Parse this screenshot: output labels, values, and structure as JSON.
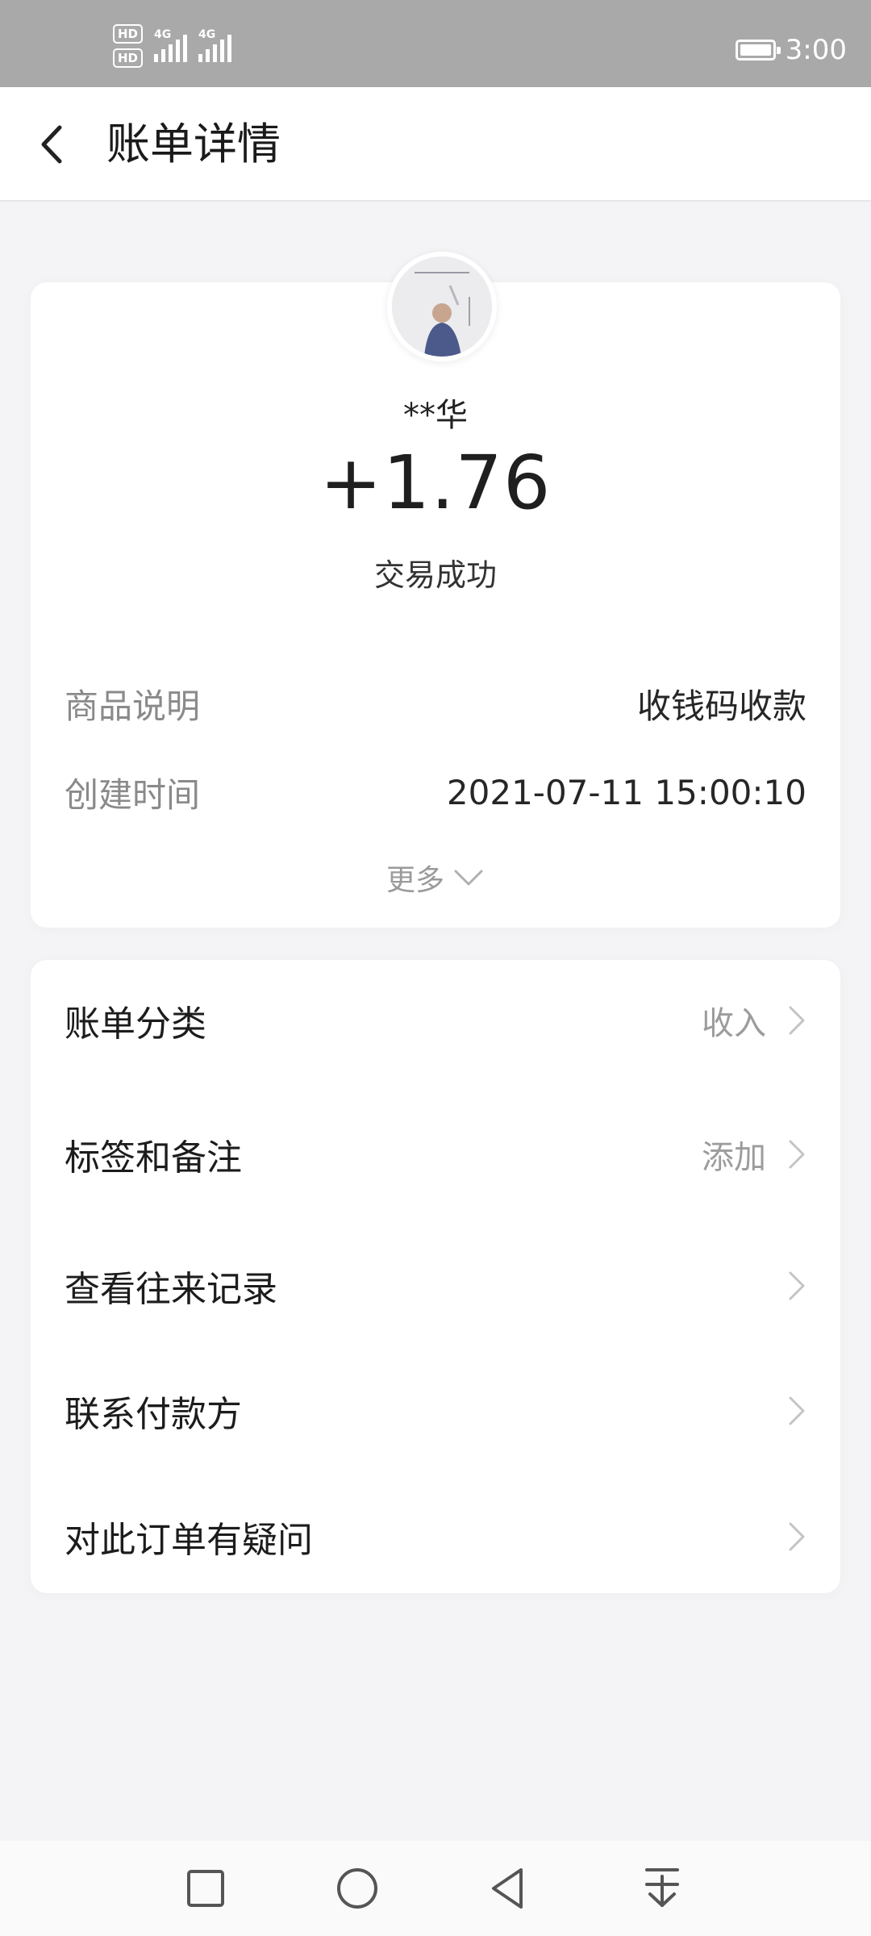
{
  "status_bar": {
    "sim1_tag": "HD",
    "sim2_tag": "HD",
    "sim1_gen": "4G",
    "sim2_gen": "4G",
    "time": "3:00"
  },
  "header": {
    "title": "账单详情"
  },
  "summary": {
    "counterparty": "**华",
    "amount": "+1.76",
    "status": "交易成功",
    "details": [
      {
        "label": "商品说明",
        "value": "收钱码收款"
      },
      {
        "label": "创建时间",
        "value": "2021-07-11 15:00:10"
      }
    ],
    "more_label": "更多"
  },
  "actions": [
    {
      "label": "账单分类",
      "value": "收入"
    },
    {
      "label": "标签和备注",
      "value": "添加"
    },
    {
      "label": "查看往来记录",
      "value": ""
    },
    {
      "label": "联系付款方",
      "value": ""
    },
    {
      "label": "对此订单有疑问",
      "value": ""
    }
  ],
  "colors": {
    "status_bar_bg": "#a9a9a9",
    "page_bg": "#f4f4f6",
    "card_bg": "#ffffff",
    "muted_text": "#8a8a8a"
  },
  "icons": {
    "back": "chevron-left-icon",
    "more": "chevron-down-icon",
    "row_arrow": "chevron-right-icon",
    "nav": [
      "square-icon",
      "circle-icon",
      "triangle-back-icon",
      "download-tray-icon"
    ]
  }
}
